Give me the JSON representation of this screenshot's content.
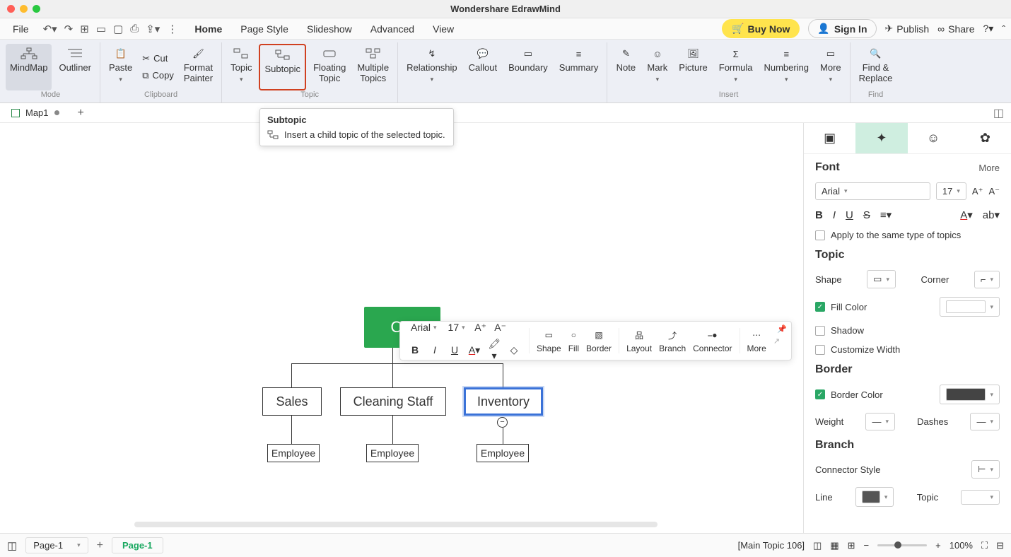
{
  "app_title": "Wondershare EdrawMind",
  "menu": {
    "file": "File",
    "tabs": [
      "Home",
      "Page Style",
      "Slideshow",
      "Advanced",
      "View"
    ],
    "active_tab": "Home",
    "buy_now": "Buy Now",
    "sign_in": "Sign In",
    "publish": "Publish",
    "share": "Share"
  },
  "ribbon": {
    "mode_label": "Mode",
    "mindmap": "MindMap",
    "outliner": "Outliner",
    "clipboard_label": "Clipboard",
    "paste": "Paste",
    "cut": "Cut",
    "copy": "Copy",
    "format_painter": "Format\nPainter",
    "topic_label": "Topic",
    "topic": "Topic",
    "subtopic": "Subtopic",
    "floating_topic": "Floating\nTopic",
    "multiple_topics": "Multiple\nTopics",
    "relationship": "Relationship",
    "callout": "Callout",
    "boundary": "Boundary",
    "summary": "Summary",
    "insert_label": "Insert",
    "note": "Note",
    "mark": "Mark",
    "picture": "Picture",
    "formula": "Formula",
    "numbering": "Numbering",
    "more": "More",
    "find_label": "Find",
    "find_replace": "Find &\nReplace"
  },
  "tooltip": {
    "title": "Subtopic",
    "body": "Insert a child topic of the selected topic."
  },
  "doc_tab": "Map1",
  "mindmap": {
    "owner": "Ow",
    "sales": "Sales",
    "cleaning": "Cleaning Staff",
    "inventory": "Inventory",
    "employee": "Employee"
  },
  "float_toolbar": {
    "font": "Arial",
    "size": "17",
    "shape": "Shape",
    "fill": "Fill",
    "border": "Border",
    "layout": "Layout",
    "branch": "Branch",
    "connector": "Connector",
    "more": "More"
  },
  "sidepanel": {
    "font_h": "Font",
    "more": "More",
    "font_name": "Arial",
    "font_size": "17",
    "apply_same": "Apply to the same type of topics",
    "topic_h": "Topic",
    "shape": "Shape",
    "corner": "Corner",
    "fill_color": "Fill Color",
    "shadow": "Shadow",
    "customize_width": "Customize Width",
    "border_h": "Border",
    "border_color": "Border Color",
    "weight": "Weight",
    "dashes": "Dashes",
    "branch_h": "Branch",
    "connector_style": "Connector Style",
    "line": "Line",
    "topic_l": "Topic"
  },
  "status": {
    "page_sel": "Page-1",
    "page_tab": "Page-1",
    "info": "[Main Topic 106]",
    "zoom": "100%"
  }
}
